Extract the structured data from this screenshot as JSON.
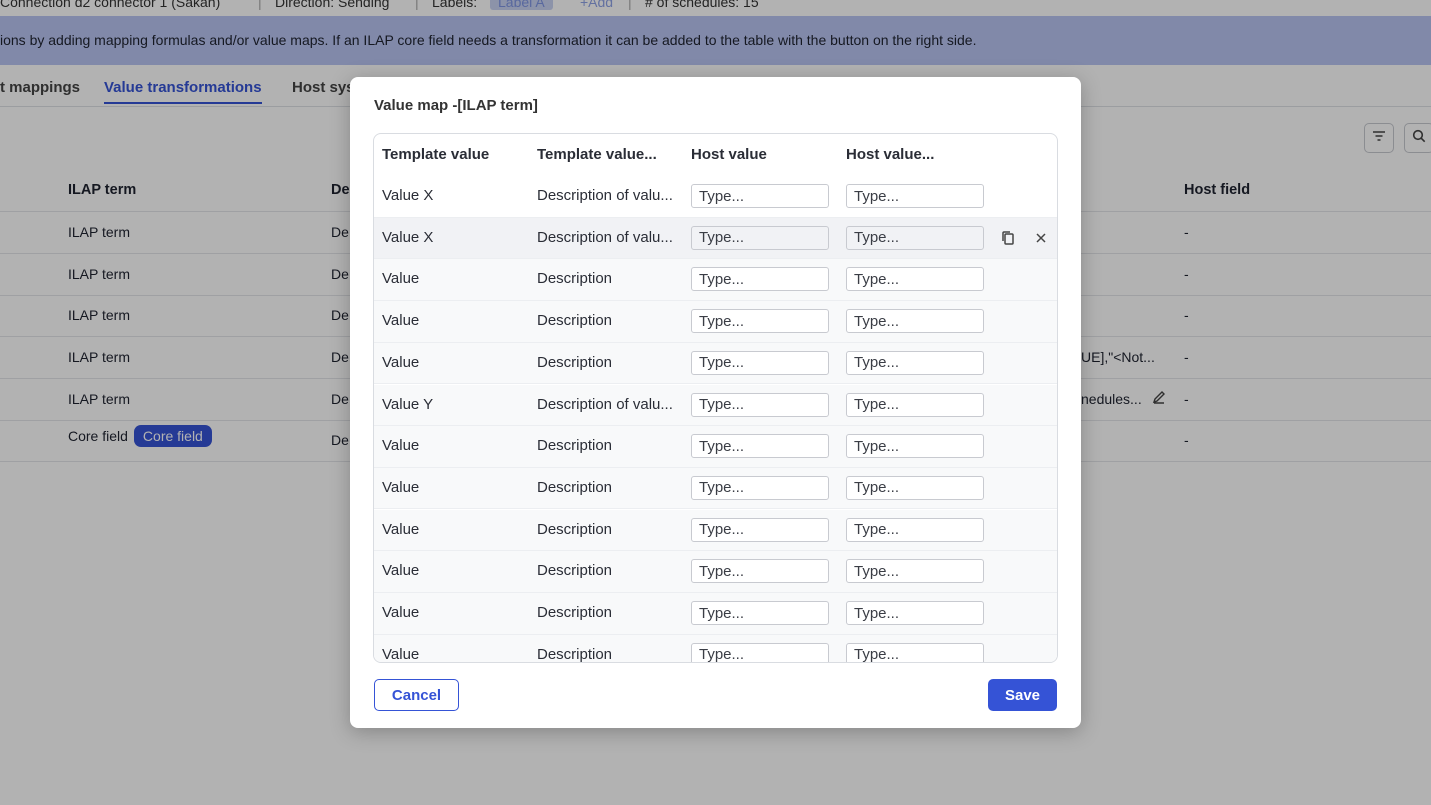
{
  "topbar": {
    "connector": "Connection d2 connector 1 (Sakan)",
    "direction": "Direction: Sending",
    "labels_label": "Labels:",
    "label_chip": "Label A",
    "add_link": "+Add",
    "schedules": "# of schedules: 15"
  },
  "banner": {
    "text": "ions by adding mapping formulas and/or value maps. If an ILAP core field needs a transformation it can be added to the table with the button on the right side."
  },
  "tabs": [
    {
      "label": "t mappings"
    },
    {
      "label": "Value transformations"
    },
    {
      "label": "Host sys"
    }
  ],
  "bg_table": {
    "headers": {
      "ilap_term": "ILAP term",
      "desc": "De",
      "host_field": "Host field"
    },
    "rows": [
      {
        "term": "ILAP term",
        "desc": "De",
        "extra": "",
        "host": "-"
      },
      {
        "term": "ILAP term",
        "desc": "De",
        "extra": "",
        "host": "-"
      },
      {
        "term": "ILAP term",
        "desc": "De",
        "extra": "",
        "host": "-"
      },
      {
        "term": "ILAP term",
        "desc": "De",
        "extra": "UE],\"<Not...",
        "host": "-"
      },
      {
        "term": "ILAP term",
        "desc": "De",
        "extra": "nedules...",
        "host": "-"
      },
      {
        "term": "Core field",
        "desc": "De",
        "extra": "",
        "host": "-",
        "badge": "Core field"
      }
    ]
  },
  "modal": {
    "title": "Value map -[ILAP term]",
    "headers": {
      "template_value": "Template value",
      "template_desc": "Template value...",
      "host_value": "Host value",
      "host_desc": "Host value..."
    },
    "placeholder": "Type...",
    "rows": [
      {
        "value": "Value X",
        "desc": "Description of valu..."
      },
      {
        "value": "Value X",
        "desc": "Description of valu..."
      },
      {
        "value": "Value",
        "desc": "Description"
      },
      {
        "value": "Value",
        "desc": "Description"
      },
      {
        "value": "Value",
        "desc": "Description"
      },
      {
        "value": "Value Y",
        "desc": "Description of valu..."
      },
      {
        "value": "Value",
        "desc": "Description"
      },
      {
        "value": "Value",
        "desc": "Description"
      },
      {
        "value": "Value",
        "desc": "Description"
      },
      {
        "value": "Value",
        "desc": "Description"
      },
      {
        "value": "Value",
        "desc": "Description"
      },
      {
        "value": "Value",
        "desc": "Description"
      }
    ],
    "cancel_label": "Cancel",
    "save_label": "Save"
  },
  "colors": {
    "accent": "#3553d6",
    "banner": "#b9c5f3",
    "overlay": "rgba(0,0,0,0.30)"
  }
}
